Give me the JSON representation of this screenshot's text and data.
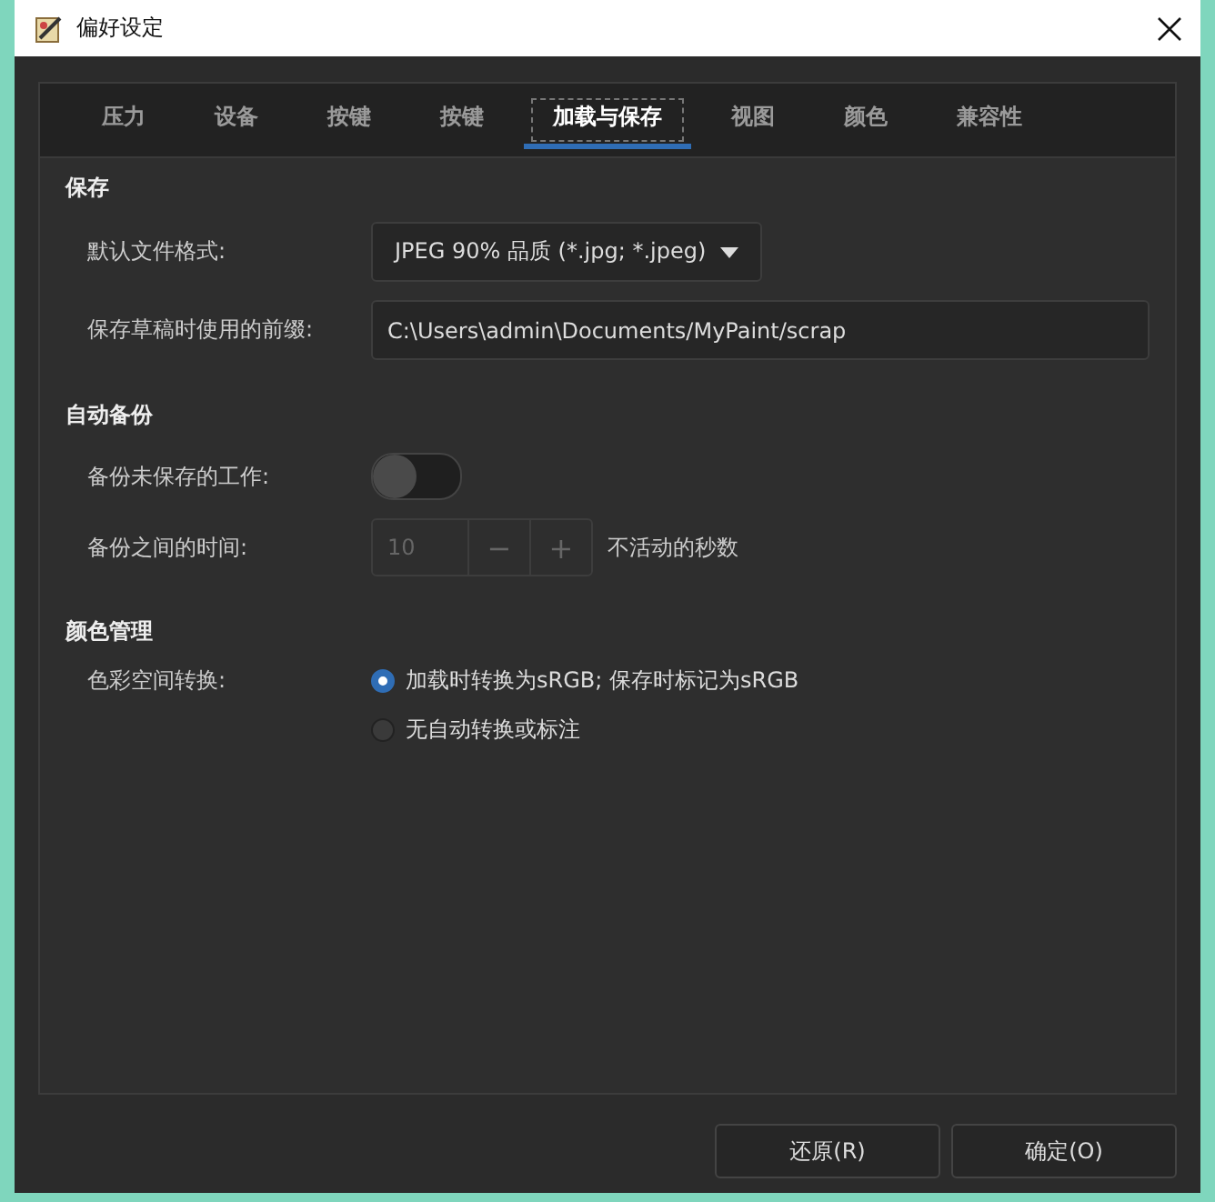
{
  "window": {
    "title": "偏好设定"
  },
  "tabs": [
    {
      "label": "压力",
      "selected": false
    },
    {
      "label": "设备",
      "selected": false
    },
    {
      "label": "按键",
      "selected": false
    },
    {
      "label": "按键",
      "selected": false
    },
    {
      "label": "加载与保存",
      "selected": true
    },
    {
      "label": "视图",
      "selected": false
    },
    {
      "label": "颜色",
      "selected": false
    },
    {
      "label": "兼容性",
      "selected": false
    }
  ],
  "save": {
    "heading": "保存",
    "format_label": "默认文件格式:",
    "format_value": "JPEG 90% 品质 (*.jpg; *.jpeg)",
    "prefix_label": "保存草稿时使用的前缀:",
    "prefix_value": "C:\\Users\\admin\\Documents/MyPaint/scrap"
  },
  "autosave": {
    "heading": "自动备份",
    "rows": [
      {
        "kind": "toggle",
        "label": "备份未保存的工作:",
        "on": false
      },
      {
        "kind": "spin",
        "label": "备份之间的时间:",
        "value": "10",
        "minus": "−",
        "plus": "+",
        "suffix": "不活动的秒数",
        "disabled": true
      }
    ]
  },
  "color_management": {
    "heading": "颜色管理",
    "label": "色彩空间转换:",
    "options": [
      {
        "label": "加载时转换为sRGB; 保存时标记为sRGB",
        "selected": true
      },
      {
        "label": "无自动转换或标注",
        "selected": false
      }
    ]
  },
  "buttons": [
    {
      "label": "还原(R)"
    },
    {
      "label": "确定(O)"
    }
  ]
}
